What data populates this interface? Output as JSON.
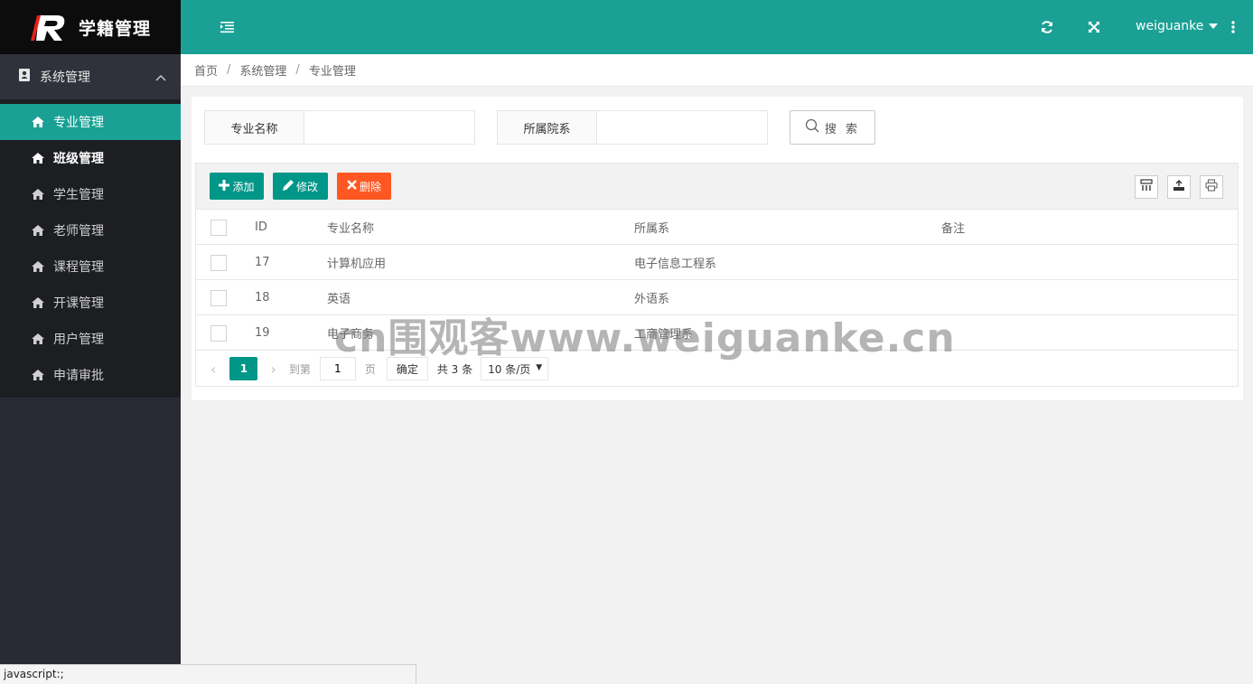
{
  "app": {
    "title": "学籍管理"
  },
  "sidebar": {
    "group_label": "系统管理",
    "items": [
      {
        "label": "专业管理"
      },
      {
        "label": "班级管理"
      },
      {
        "label": "学生管理"
      },
      {
        "label": "老师管理"
      },
      {
        "label": "课程管理"
      },
      {
        "label": "开课管理"
      },
      {
        "label": "用户管理"
      },
      {
        "label": "申请审批"
      }
    ]
  },
  "header": {
    "username": "weiguanke"
  },
  "breadcrumb": [
    "首页",
    "系统管理",
    "专业管理"
  ],
  "search": {
    "field1_label": "专业名称",
    "field1_value": "",
    "field2_label": "所属院系",
    "field2_value": "",
    "button_label": "搜 索"
  },
  "toolbar": {
    "add_label": "添加",
    "edit_label": "修改",
    "delete_label": "删除"
  },
  "table": {
    "columns": [
      "ID",
      "专业名称",
      "所属系",
      "备注"
    ],
    "rows": [
      {
        "id": "17",
        "name": "计算机应用",
        "dept": "电子信息工程系",
        "note": ""
      },
      {
        "id": "18",
        "name": "英语",
        "dept": "外语系",
        "note": ""
      },
      {
        "id": "19",
        "name": "电子商务",
        "dept": "工商管理系",
        "note": ""
      }
    ]
  },
  "pager": {
    "current": "1",
    "goto_label": "到第",
    "goto_value": "1",
    "page_label": "页",
    "confirm_label": "确定",
    "total_label": "共 3 条",
    "limit_label": "10 条/页"
  },
  "watermark": "cn围观客www.weiguanke.cn",
  "statusbar": {
    "text": "javascript:;"
  },
  "colors": {
    "accent": "#1aa094",
    "danger": "#ff5722",
    "sidebar": "#282b33"
  }
}
